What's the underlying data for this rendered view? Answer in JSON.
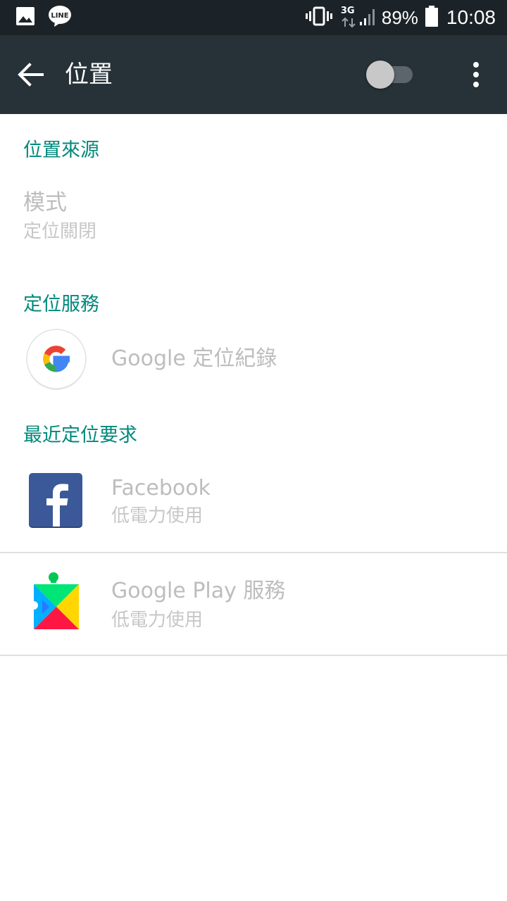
{
  "status_bar": {
    "left_icons": [
      "image-icon",
      "line-app-icon"
    ],
    "line_badge": "LINE",
    "network_type": "3G",
    "battery_percent": "89%",
    "time": "10:08"
  },
  "app_bar": {
    "title": "位置",
    "location_toggle": "off",
    "icons": [
      "back-arrow-icon",
      "overflow-menu-icon"
    ]
  },
  "sections": {
    "location_source": {
      "header": "位置來源",
      "mode_title": "模式",
      "mode_summary": "定位關閉"
    },
    "location_services": {
      "header": "定位服務",
      "items": [
        {
          "title": "Google 定位紀錄",
          "icon": "google-g-icon"
        }
      ]
    },
    "recent_requests": {
      "header": "最近定位要求",
      "items": [
        {
          "title": "Facebook",
          "subtitle": "低電力使用",
          "icon": "facebook-icon"
        },
        {
          "title": "Google Play 服務",
          "subtitle": "低電力使用",
          "icon": "google-play-services-icon"
        }
      ]
    }
  },
  "colors": {
    "status_bar_bg": "#1c2328",
    "app_bar_bg": "#263238",
    "accent": "#00897b",
    "disabled_text": "#bdbdbd"
  }
}
